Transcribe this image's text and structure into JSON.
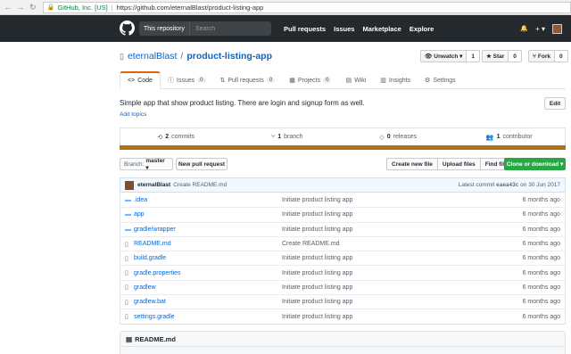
{
  "browser": {
    "secure_label": "GitHub, Inc. [US]",
    "url": "https://github.com/eternalBlast/product-listing-app"
  },
  "header": {
    "scope": "This repository",
    "search_placeholder": "Search",
    "links": [
      "Pull requests",
      "Issues",
      "Marketplace",
      "Explore"
    ],
    "plus": "+ ▾",
    "bell": "🔔"
  },
  "repo": {
    "owner": "eternalBlast",
    "separator": "/",
    "name": "product-listing-app",
    "unwatch": "Unwatch ▾",
    "unwatch_count": "1",
    "star": "★ Star",
    "star_count": "0",
    "fork": "Fork",
    "fork_count": "0"
  },
  "tabs": [
    {
      "label": "Code",
      "counter": "",
      "icon": "<>"
    },
    {
      "label": "Issues",
      "counter": "0",
      "icon": "ⓘ"
    },
    {
      "label": "Pull requests",
      "counter": "0",
      "icon": "⇅"
    },
    {
      "label": "Projects",
      "counter": "0",
      "icon": "▦"
    },
    {
      "label": "Wiki",
      "counter": "",
      "icon": "▤"
    },
    {
      "label": "Insights",
      "counter": "",
      "icon": "▥"
    },
    {
      "label": "Settings",
      "counter": "",
      "icon": "⚙"
    }
  ],
  "description": "Simple app that show product listing. There are login and signup form as well.",
  "add_topics": "Add topics",
  "edit": "Edit",
  "summary": {
    "commits_count": "2",
    "commits_label": "commits",
    "branch_count": "1",
    "branch_label": "branch",
    "releases_count": "0",
    "releases_label": "releases",
    "contributor_count": "1",
    "contributor_label": "contributor"
  },
  "language_color": "#b07219",
  "file_nav": {
    "branch_prefix": "Branch:",
    "branch": "master ▾",
    "new_pr": "New pull request",
    "create_file": "Create new file",
    "upload": "Upload files",
    "find": "Find file",
    "clone": "Clone or download ▾"
  },
  "commit": {
    "author": "eternalBlast",
    "message": "Create README.md",
    "latest_label": "Latest commit",
    "sha": "eaea43c",
    "date": "on 30 Jun 2017"
  },
  "files": [
    {
      "name": ".idea",
      "type": "dir",
      "message": "Initiate product listing app",
      "age": "6 months ago"
    },
    {
      "name": "app",
      "type": "dir",
      "message": "Initiate product listing app",
      "age": "6 months ago"
    },
    {
      "name": "gradle/wrapper",
      "type": "dir",
      "message": "Initiate product listing app",
      "age": "6 months ago"
    },
    {
      "name": "README.md",
      "type": "file",
      "message": "Create README.md",
      "age": "6 months ago"
    },
    {
      "name": "build.gradle",
      "type": "file",
      "message": "Initiate product listing app",
      "age": "6 months ago"
    },
    {
      "name": "gradle.properties",
      "type": "file",
      "message": "Initiate product listing app",
      "age": "6 months ago"
    },
    {
      "name": "gradlew",
      "type": "file",
      "message": "Initiate product listing app",
      "age": "6 months ago"
    },
    {
      "name": "gradlew.bat",
      "type": "file",
      "message": "Initiate product listing app",
      "age": "6 months ago"
    },
    {
      "name": "settings.gradle",
      "type": "file",
      "message": "Initiate product listing app",
      "age": "6 months ago"
    }
  ],
  "readme_title": "README.md"
}
